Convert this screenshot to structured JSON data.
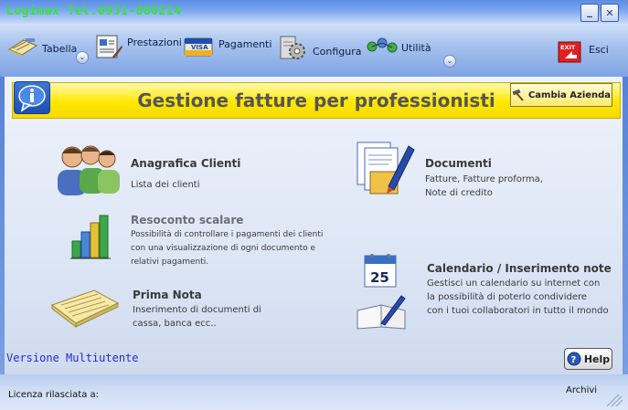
{
  "window": {
    "title": "Logimax Tel.0931-880214",
    "minimize_glyph": "_",
    "close_glyph": "✕"
  },
  "toolbar": {
    "items": [
      {
        "label": "Tabella",
        "icon": "tabella-icon",
        "has_dropdown": true
      },
      {
        "label": "Prestazioni",
        "icon": "prestazioni-icon",
        "has_dropdown": false
      },
      {
        "label": "Pagamenti",
        "icon": "visa-card-icon",
        "has_dropdown": false
      },
      {
        "label": "Configura",
        "icon": "gears-icon",
        "has_dropdown": false
      },
      {
        "label": "Utilità",
        "icon": "network-icon",
        "has_dropdown": true
      },
      {
        "label": "Esci",
        "icon": "exit-icon",
        "has_dropdown": false
      }
    ],
    "exit_icon_text": "EXIT"
  },
  "banner": {
    "title": "Gestione fatture per professionisti",
    "cambia_label": "Cambia Azienda",
    "background": "#ffe800"
  },
  "features": {
    "anagrafica": {
      "title": "Anagrafica Clienti",
      "desc": "Lista dei clienti"
    },
    "resoconto": {
      "title": "Resoconto scalare",
      "desc_lines": [
        "Possibilità di controllare i pagamenti dei clienti",
        "con una visualizzazione di ogni documento e",
        "relativi pagamenti."
      ]
    },
    "primanota": {
      "title": "Prima Nota",
      "desc_lines": [
        "Inserimento di documenti di",
        "cassa, banca ecc.."
      ]
    },
    "documenti": {
      "title": "Documenti",
      "desc_lines": [
        "Fatture, Fatture proforma,",
        "Note di credito"
      ]
    },
    "calendario": {
      "title": "Calendario / Inserimento note",
      "calendar_day": "25",
      "desc_lines": [
        "Gestisci un calendario su internet con",
        "la possibilità di poterlo condividere",
        "con i tuoi collaboratori in tutto il mondo"
      ]
    }
  },
  "footer": {
    "versione": "Versione Multiutente",
    "help_label": "Help",
    "licenza_label": "Licenza rilasciata a:",
    "archivi_label": "Archivi"
  },
  "colors": {
    "title_text": "#38e238",
    "versione_text": "#1f2fd6",
    "banner_yellow": "#ffe800"
  }
}
